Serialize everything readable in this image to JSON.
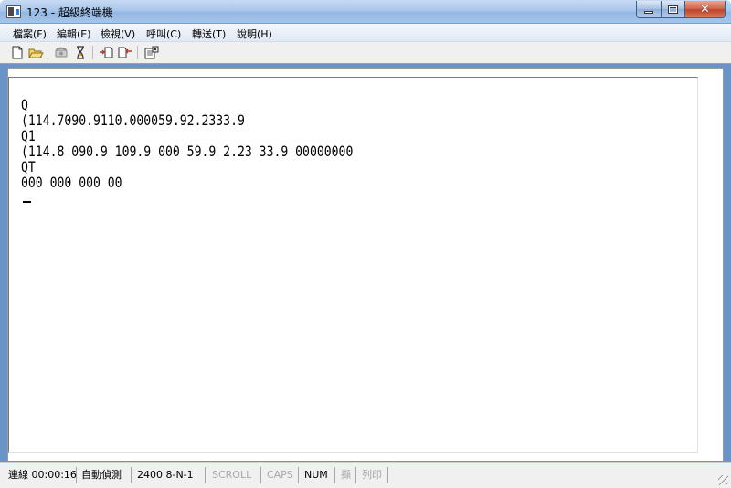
{
  "window": {
    "title": "123 - 超級終端機"
  },
  "menu": {
    "items": [
      {
        "label": "檔案(F)"
      },
      {
        "label": "編輯(E)"
      },
      {
        "label": "檢視(V)"
      },
      {
        "label": "呼叫(C)"
      },
      {
        "label": "轉送(T)"
      },
      {
        "label": "說明(H)"
      }
    ]
  },
  "toolbar": {
    "buttons": [
      {
        "icon": "new-document-icon"
      },
      {
        "icon": "open-folder-icon"
      },
      {
        "icon": "call-icon"
      },
      {
        "icon": "disconnect-icon"
      },
      {
        "icon": "send-file-icon"
      },
      {
        "icon": "receive-file-icon"
      },
      {
        "icon": "properties-icon"
      }
    ]
  },
  "terminal": {
    "lines": [
      "Q",
      "(114.7090.9110.000059.92.2333.9",
      "Q1",
      "(114.8 090.9 109.9 000 59.9 2.23 33.9 00000000",
      "QT",
      "000 000 000 00"
    ]
  },
  "status": {
    "connection": "連線 00:00:16",
    "detect": "自動偵測",
    "port_settings": "2400 8-N-1",
    "scroll": "SCROLL",
    "caps": "CAPS",
    "num": "NUM",
    "capture": "擷",
    "print_echo": "列印"
  }
}
